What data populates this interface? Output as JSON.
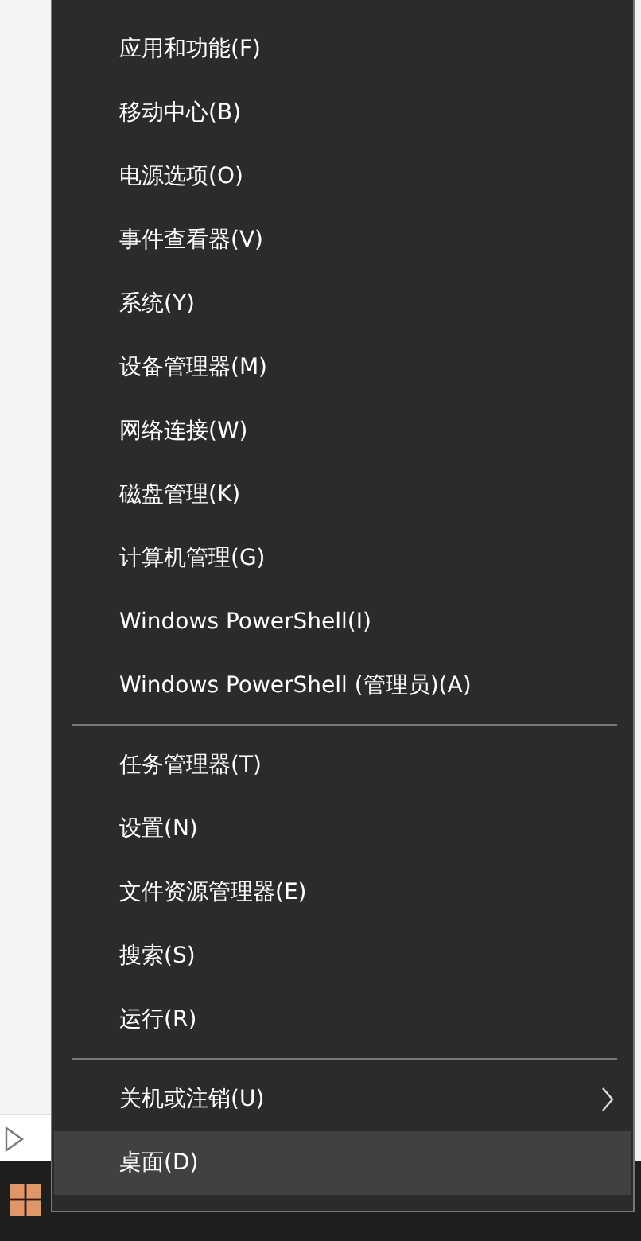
{
  "menu": {
    "sections": [
      {
        "items": [
          {
            "label": "应用和功能(F)",
            "selected": false,
            "has_submenu": false
          },
          {
            "label": "移动中心(B)",
            "selected": false,
            "has_submenu": false
          },
          {
            "label": "电源选项(O)",
            "selected": false,
            "has_submenu": false
          },
          {
            "label": "事件查看器(V)",
            "selected": false,
            "has_submenu": false
          },
          {
            "label": "系统(Y)",
            "selected": false,
            "has_submenu": false
          },
          {
            "label": "设备管理器(M)",
            "selected": false,
            "has_submenu": false
          },
          {
            "label": "网络连接(W)",
            "selected": false,
            "has_submenu": false
          },
          {
            "label": "磁盘管理(K)",
            "selected": false,
            "has_submenu": false
          },
          {
            "label": "计算机管理(G)",
            "selected": false,
            "has_submenu": false
          },
          {
            "label": "Windows PowerShell(I)",
            "selected": false,
            "has_submenu": false
          },
          {
            "label": "Windows PowerShell (管理员)(A)",
            "selected": false,
            "has_submenu": false
          }
        ]
      },
      {
        "items": [
          {
            "label": "任务管理器(T)",
            "selected": false,
            "has_submenu": false
          },
          {
            "label": "设置(N)",
            "selected": false,
            "has_submenu": false
          },
          {
            "label": "文件资源管理器(E)",
            "selected": false,
            "has_submenu": false
          },
          {
            "label": "搜索(S)",
            "selected": false,
            "has_submenu": false
          },
          {
            "label": "运行(R)",
            "selected": false,
            "has_submenu": false
          }
        ]
      },
      {
        "items": [
          {
            "label": "关机或注销(U)",
            "selected": false,
            "has_submenu": true
          },
          {
            "label": "桌面(D)",
            "selected": true,
            "has_submenu": false
          }
        ]
      }
    ]
  }
}
